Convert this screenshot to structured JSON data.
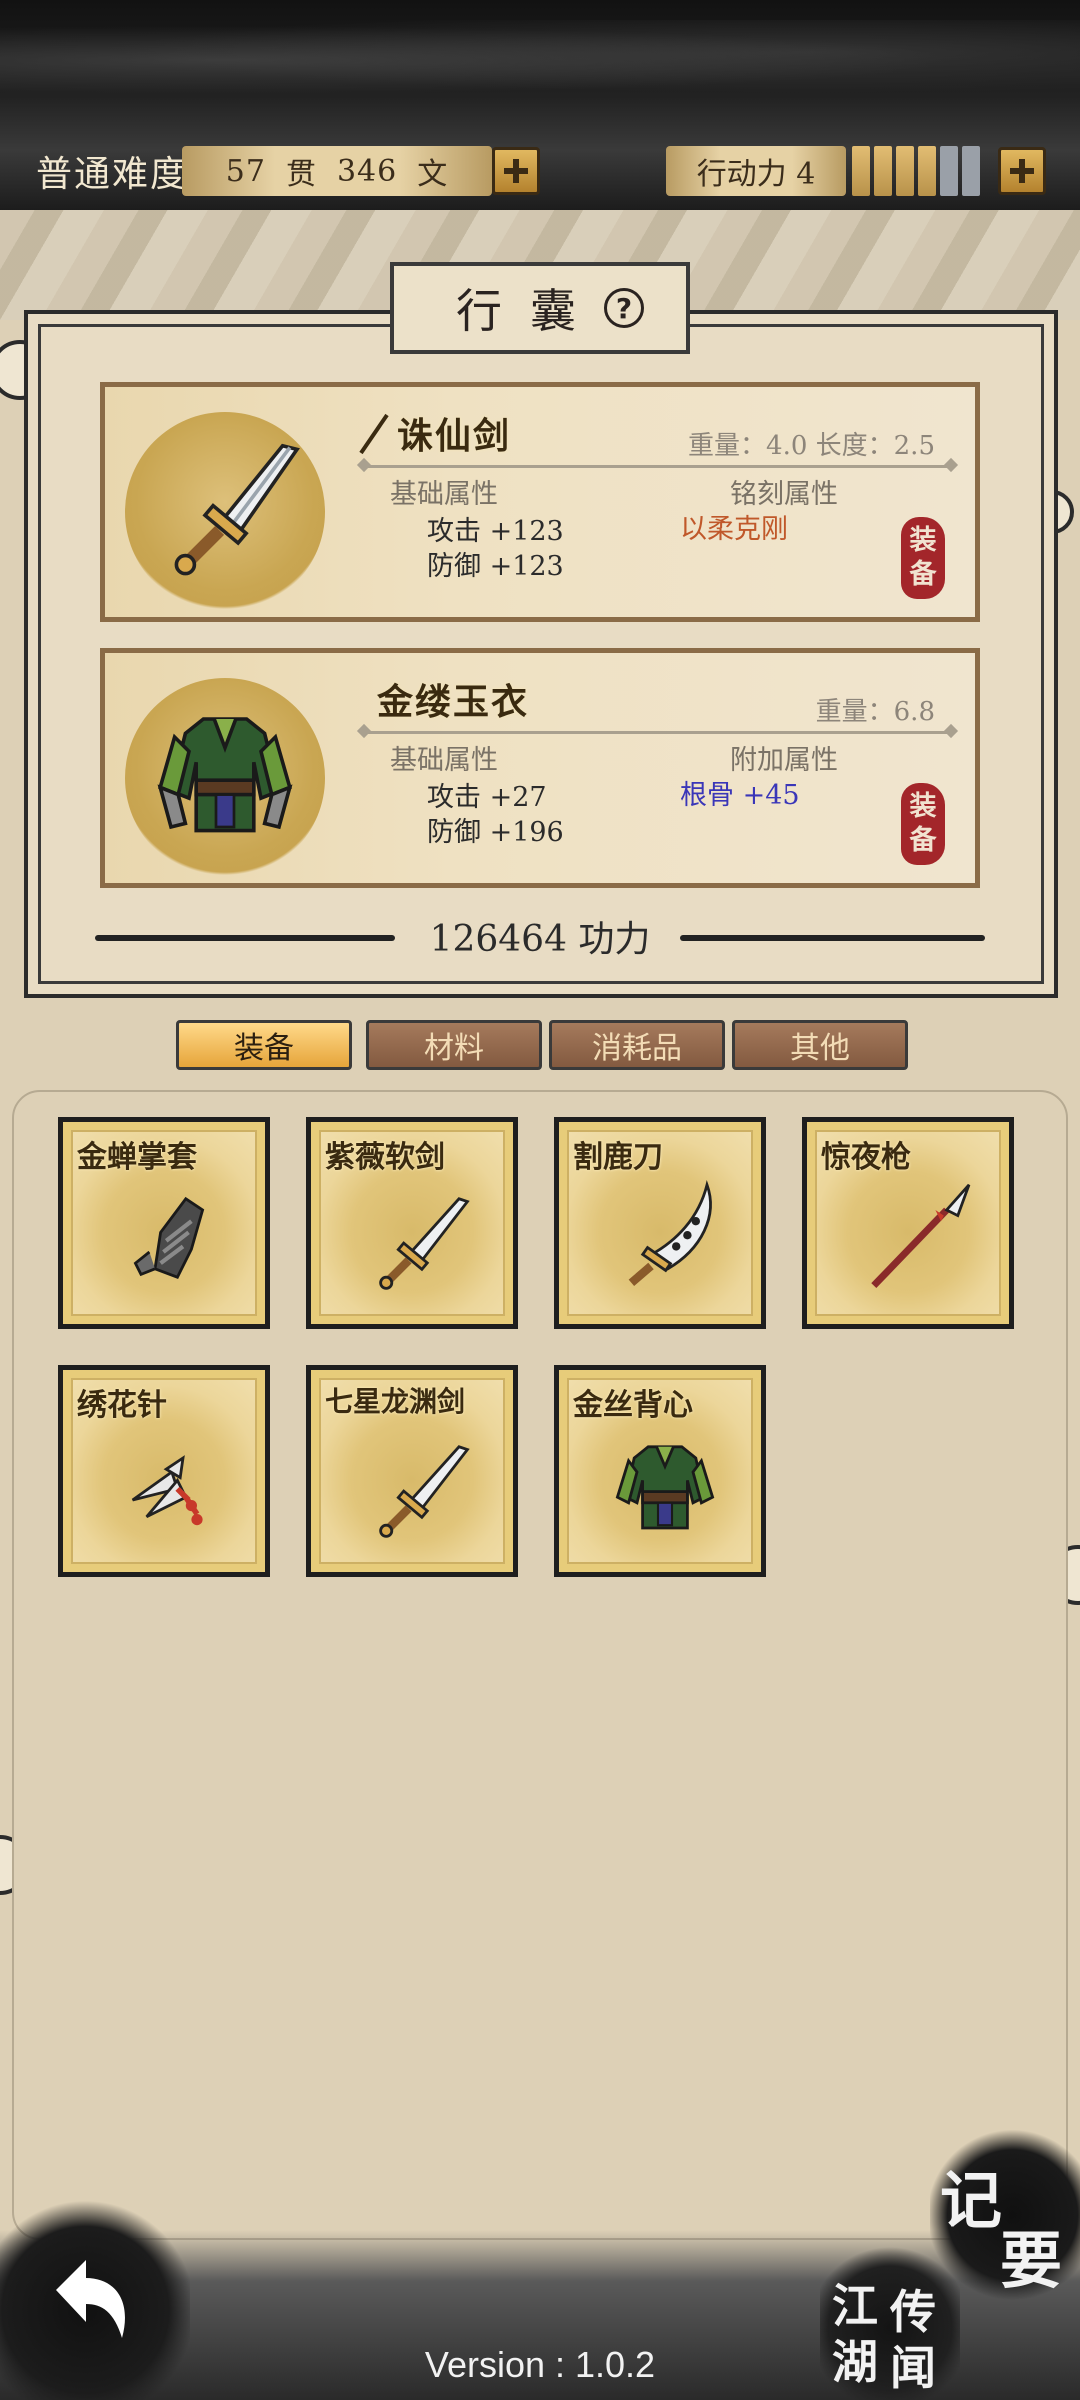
{
  "top_bar": {
    "difficulty": "普通难度",
    "money": {
      "guan": "57",
      "guan_unit": "贯",
      "wen": "346",
      "wen_unit": "文"
    },
    "action_label": "行动力 4",
    "action_points": {
      "current": 4,
      "max": 6
    }
  },
  "panel": {
    "title": "行囊",
    "help_symbol": "?"
  },
  "equipped": [
    {
      "name": "诛仙剑",
      "meta": "重量：4.0  长度：2.5",
      "base_label": "基础属性",
      "attack": "攻击 +123",
      "defense": "防御 +123",
      "extra_label": "铭刻属性",
      "extra_value": "以柔克刚",
      "extra_color": "#c0582a",
      "seal": "装备",
      "icon": "sword-icon"
    },
    {
      "name": "金缕玉衣",
      "meta": "重量：6.8",
      "base_label": "基础属性",
      "attack": "攻击 +27",
      "defense": "防御 +196",
      "extra_label": "附加属性",
      "extra_value": "根骨 +45",
      "extra_color": "#3a36b8",
      "seal": "装备",
      "icon": "robe-icon"
    }
  ],
  "power": "126464 功力",
  "tabs": [
    {
      "label": "装备",
      "active": true
    },
    {
      "label": "材料",
      "active": false
    },
    {
      "label": "消耗品",
      "active": false
    },
    {
      "label": "其他",
      "active": false
    }
  ],
  "inventory": [
    {
      "name": "金蝉掌套",
      "icon": "gauntlet-icon"
    },
    {
      "name": "紫薇软剑",
      "icon": "sword-icon"
    },
    {
      "name": "割鹿刀",
      "icon": "saber-icon"
    },
    {
      "name": "惊夜枪",
      "icon": "spear-icon"
    },
    {
      "name": "绣花针",
      "icon": "needles-icon"
    },
    {
      "name": "七星龙渊剑",
      "icon": "sword-icon"
    },
    {
      "name": "金丝背心",
      "icon": "robe-icon"
    }
  ],
  "bottom": {
    "jiyao_1": "记",
    "jiyao_2": "要",
    "chuanwen_1": "江",
    "chuanwen_2": "湖",
    "chuanwen_3": "传",
    "chuanwen_4": "闻",
    "version": "Version : 1.0.2"
  },
  "colors": {
    "accent": "#e6a53a",
    "seal": "#a3262a",
    "parchment": "#ddd0b6"
  }
}
